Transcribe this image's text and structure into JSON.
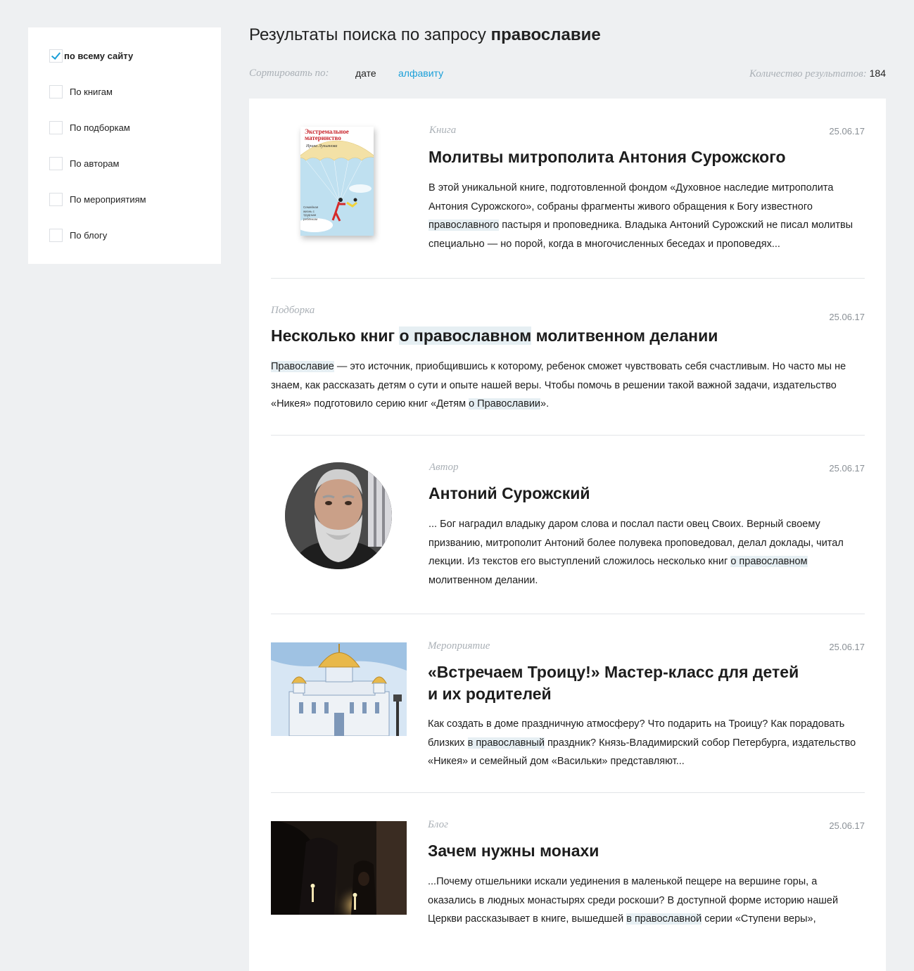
{
  "filters": [
    {
      "label": "по всему сайту",
      "checked": true
    },
    {
      "label": "По книгам",
      "checked": false
    },
    {
      "label": "По подборкам",
      "checked": false
    },
    {
      "label": "По авторам",
      "checked": false
    },
    {
      "label": "По мероприятиям",
      "checked": false
    },
    {
      "label": "По блогу",
      "checked": false
    }
  ],
  "header": {
    "title_prefix": "Результаты поиска по запросу ",
    "query": "православие",
    "sort_label": "Сортировать по:",
    "sort_date": "дате",
    "sort_alpha": "алфавиту",
    "count_label": "Количество результатов:",
    "count_value": "184"
  },
  "results": [
    {
      "type": "Книга",
      "date": "25.06.17",
      "title": "Молитвы митрополита Антония Сурожского",
      "text": [
        {
          "t": "В этой уникальной книге, подготовленной фондом «Духовное наследие митрополита Антония Сурожского», собраны фрагменты живого обращения к Богу известного "
        },
        {
          "t": "православного",
          "hl": true
        },
        {
          "t": " пастыря и проповедника. Владыка Антоний Сурожский не писал молитвы специально — но порой, когда в многочисленных беседах и проповедях..."
        }
      ],
      "cover_title": "Экстремальное материнство",
      "cover_author": "Ирина Лукьянова",
      "cover_tagline": "Семейная жизнь с трудным ребёнком"
    },
    {
      "type": "Подборка",
      "date": "25.06.17",
      "title": [
        {
          "t": "Несколько книг "
        },
        {
          "t": "о православном",
          "hl": true
        },
        {
          "t": " молитвенном делании"
        }
      ],
      "text": [
        {
          "t": "Православие",
          "hl": true
        },
        {
          "t": " — это источник, приобщившись к которому, ребенок сможет чувствовать себя счастливым. Но часто мы не знаем, как рассказать детям о сути и опыте нашей веры. Чтобы помочь в решении такой важной задачи, издательство «Никея» подготовило серию книг «Детям "
        },
        {
          "t": "о Православии",
          "hl": true
        },
        {
          "t": "»."
        }
      ]
    },
    {
      "type": "Автор",
      "date": "25.06.17",
      "title": "Антоний Сурожский",
      "text": [
        {
          "t": "... Бог наградил владыку даром слова и послал пасти овец Своих. Верный своему призванию, митрополит Антоний более полувека проповедовал, делал доклады, читал лекции. Из текстов его выступлений сложилось несколько книг "
        },
        {
          "t": "о православном",
          "hl": true
        },
        {
          "t": " молитвенном делании."
        }
      ]
    },
    {
      "type": "Мероприятие",
      "date": "25.06.17",
      "title": "«Встречаем Троицу!» Мастер-класс для детей\nи их родителей",
      "text": [
        {
          "t": "Как создать в доме праздничную атмосферу? Что подарить на Троицу? Как порадовать близких "
        },
        {
          "t": "в православный",
          "hl": true
        },
        {
          "t": " праздник? Князь-Владимирский собор Петербурга, издательство «Никея» и семейный дом «Васильки» представляют..."
        }
      ]
    },
    {
      "type": "Блог",
      "date": "25.06.17",
      "title": "Зачем нужны монахи",
      "text": [
        {
          "t": "...Почему отшельники искали уединения в маленькой пещере на вершине горы, а оказались в людных монастырях среди роскоши? В доступной форме историю нашей Церкви рассказывает в книге, вышедшей "
        },
        {
          "t": "в православной",
          "hl": true
        },
        {
          "t": " серии «Ступени веры»,"
        }
      ]
    }
  ],
  "colors": {
    "accent": "#1a9fd8",
    "highlight": "#e6eff3",
    "background": "#eef0f2",
    "muted": "#aab0b6"
  }
}
